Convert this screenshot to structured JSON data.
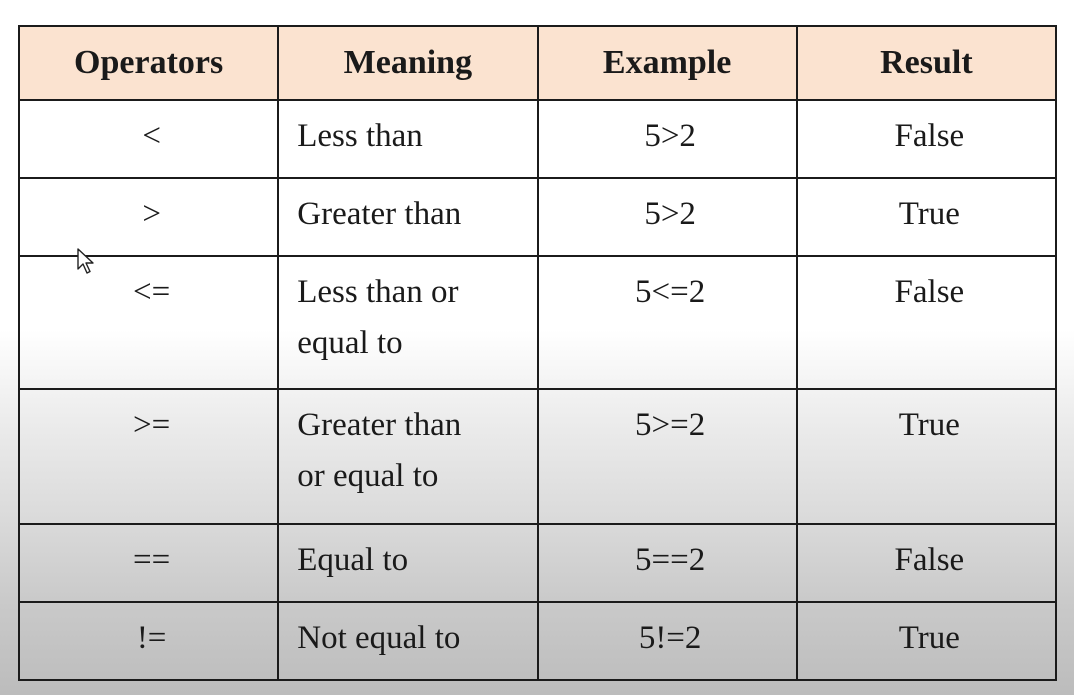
{
  "table": {
    "headers": [
      "Operators",
      "Meaning",
      "Example",
      "Result"
    ],
    "rows": [
      {
        "operator": "<",
        "meaning": [
          "Less than"
        ],
        "example": "5>2",
        "result": "False"
      },
      {
        "operator": ">",
        "meaning": [
          "Greater than"
        ],
        "example": "5>2",
        "result": "True"
      },
      {
        "operator": "<=",
        "meaning": [
          "Less than or",
          "equal to"
        ],
        "example": "5<=2",
        "result": "False"
      },
      {
        "operator": ">=",
        "meaning": [
          "Greater than",
          "or equal to"
        ],
        "example": "5>=2",
        "result": "True"
      },
      {
        "operator": "==",
        "meaning": [
          "Equal to"
        ],
        "example": "5==2",
        "result": "False"
      },
      {
        "operator": "!=",
        "meaning": [
          "Not equal to"
        ],
        "example": "5!=2",
        "result": "True"
      }
    ]
  },
  "colors": {
    "header_background": "#fbe3d0",
    "border": "#1b1b1b",
    "text": "#1a1a1a"
  },
  "icons": {
    "cursor": "mouse-pointer-icon"
  }
}
